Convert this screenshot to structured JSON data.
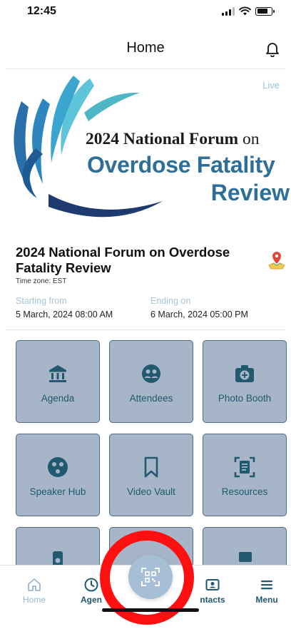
{
  "status_bar": {
    "time": "12:45"
  },
  "header": {
    "title": "Home",
    "bell_icon": "bell-icon"
  },
  "banner": {
    "live_label": "Live",
    "line1_main": "2024 National Forum",
    "line1_suffix": " on",
    "line2": "Overdose Fatality",
    "line3": "Review",
    "colors": {
      "brand_blue": "#2e6f99",
      "swirl_light": "#5ec5d8",
      "swirl_dark": "#1e3a6e"
    }
  },
  "event": {
    "title": "2024 National Forum on Overdose Fatality Review",
    "timezone": "Time zone: EST",
    "start_label": "Starting from",
    "start_value": "5 March, 2024   08:00 AM",
    "end_label": "Ending on",
    "end_value": "6 March, 2024   05:00 PM"
  },
  "tiles": [
    {
      "label": "Agenda",
      "icon": "bank-icon"
    },
    {
      "label": "Attendees",
      "icon": "attendees-icon"
    },
    {
      "label": "Photo Booth",
      "icon": "camera-plus-icon"
    },
    {
      "label": "Speaker Hub",
      "icon": "speaker-hub-icon"
    },
    {
      "label": "Video Vault",
      "icon": "bookmark-icon"
    },
    {
      "label": "Resources",
      "icon": "document-scan-icon"
    }
  ],
  "bottom_nav": {
    "home_label": "Home",
    "agenda_label": "Agen",
    "contacts_label": "ntacts",
    "menu_label": "Menu",
    "active_color": "#21596f",
    "inactive_color": "#9cb7cc"
  },
  "scan_button": {
    "icon": "qr-scan-icon"
  },
  "annotation": {
    "color": "#ff1010"
  }
}
